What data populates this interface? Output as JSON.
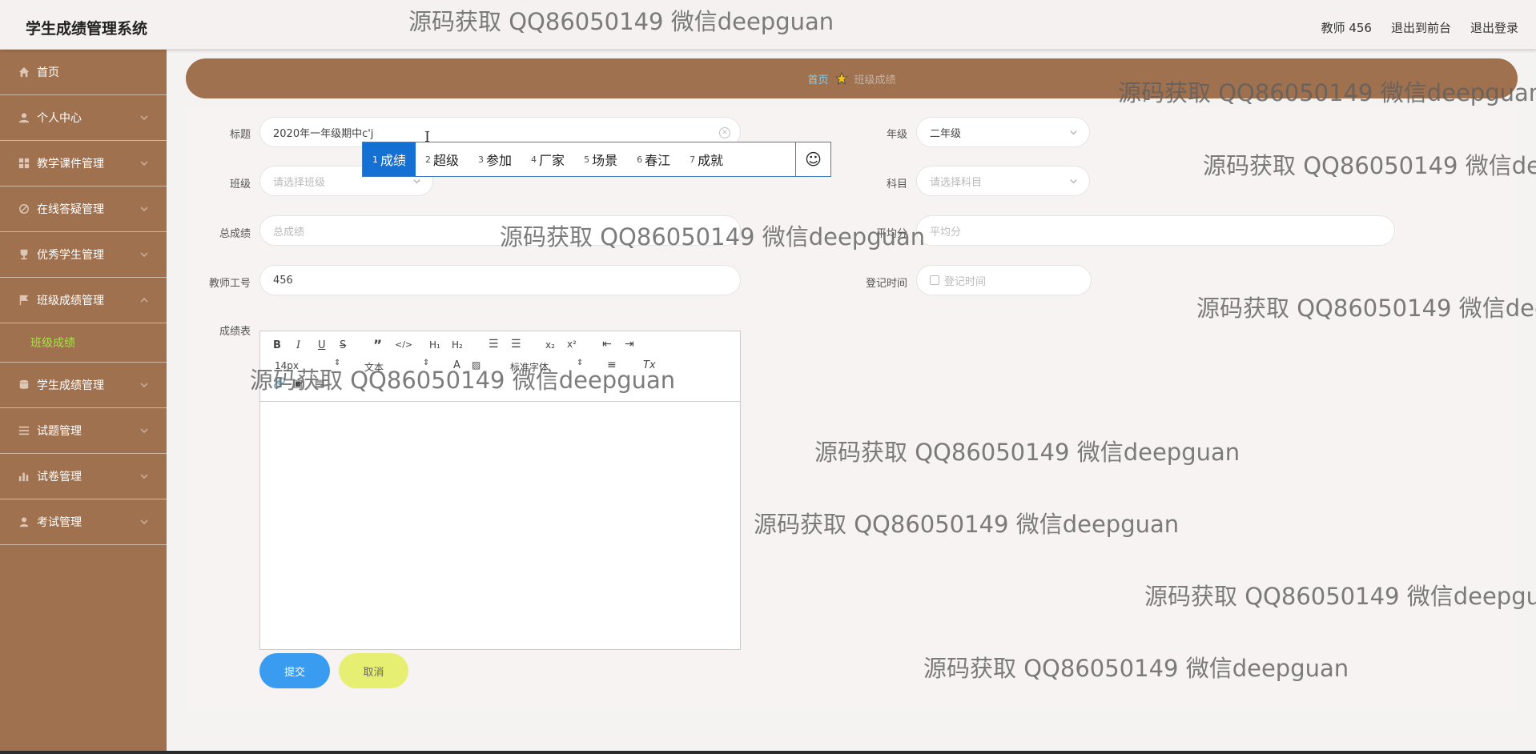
{
  "header": {
    "app_title": "学生成绩管理系统",
    "user_label": "教师 456",
    "to_frontend": "退出到前台",
    "logout": "退出登录"
  },
  "sidebar": {
    "items": [
      {
        "label": "首页",
        "icon": "home-icon"
      },
      {
        "label": "个人中心",
        "icon": "user-icon"
      },
      {
        "label": "教学课件管理",
        "icon": "grid-icon"
      },
      {
        "label": "在线答疑管理",
        "icon": "no-icon"
      },
      {
        "label": "优秀学生管理",
        "icon": "trophy-icon"
      },
      {
        "label": "班级成绩管理",
        "icon": "flag-icon"
      },
      {
        "label": "学生成绩管理",
        "icon": "database-icon"
      },
      {
        "label": "试题管理",
        "icon": "list-icon"
      },
      {
        "label": "试卷管理",
        "icon": "bar-chart-icon"
      },
      {
        "label": "考试管理",
        "icon": "person-icon"
      }
    ],
    "sub_item": "班级成绩"
  },
  "breadcrumb": {
    "home": "首页",
    "current": "班级成绩"
  },
  "form": {
    "title_label": "标题",
    "title_value": "2020年一年级期中c'j",
    "grade_label": "年级",
    "grade_value": "二年级",
    "class_label": "班级",
    "class_placeholder": "请选择班级",
    "subject_label": "科目",
    "subject_placeholder": "请选择科目",
    "total_label": "总成绩",
    "total_placeholder": "总成绩",
    "avg_label": "平均分",
    "avg_placeholder": "平均分",
    "teacher_label": "教师工号",
    "teacher_value": "456",
    "time_label": "登记时间",
    "time_placeholder": "登记时间",
    "table_label": "成绩表",
    "submit": "提交",
    "cancel": "取消"
  },
  "editor": {
    "font_size": "14px",
    "text_style": "文本",
    "font_family": "标准字体"
  },
  "ime": {
    "candidates": [
      {
        "n": "1",
        "text": "成绩"
      },
      {
        "n": "2",
        "text": "超级"
      },
      {
        "n": "3",
        "text": "参加"
      },
      {
        "n": "4",
        "text": "厂家"
      },
      {
        "n": "5",
        "text": "场景"
      },
      {
        "n": "6",
        "text": "春江"
      },
      {
        "n": "7",
        "text": "成就"
      }
    ]
  },
  "watermark": "源码获取 QQ86050149 微信deepguan"
}
